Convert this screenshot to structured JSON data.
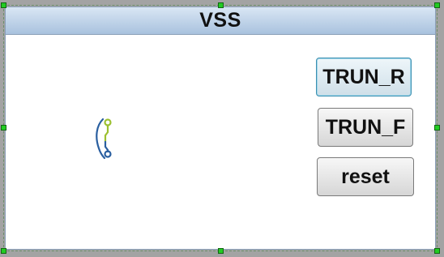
{
  "panel": {
    "title": "VSS"
  },
  "buttons": {
    "turn_r": "TRUN_R",
    "turn_f": "TRUN_F",
    "reset": "reset"
  },
  "icons": {
    "logo": "circuit-logo-icon",
    "handle": "resize-handle-icon"
  },
  "colors": {
    "title_bar": "#b9cfe6",
    "handle": "#22cc22",
    "active_button_border": "#3c8fb0",
    "logo_blue": "#2a5fa0",
    "logo_green": "#9cc030"
  }
}
